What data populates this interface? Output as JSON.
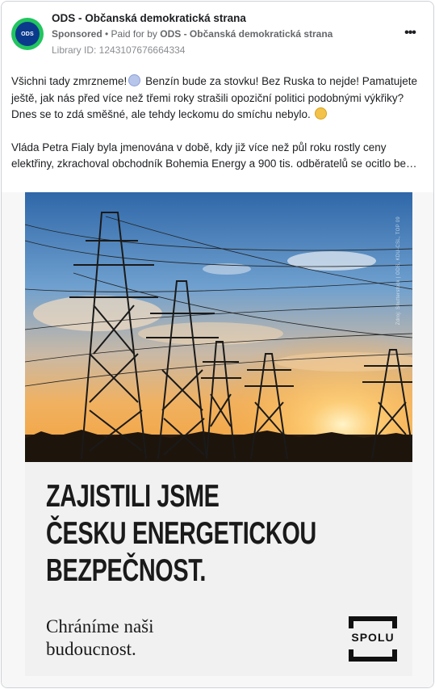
{
  "post": {
    "page_name": "ODS - Občanská demokratická strana",
    "avatar_text": "ODS",
    "sponsored_label": "Sponsored",
    "paid_for_prefix": "• Paid for by",
    "paid_for_name": "ODS - Občanská demokratická strana",
    "library_id": "Library ID: 1243107676664334",
    "more_icon": "more-horizontal-icon"
  },
  "body": {
    "line1_a": "Všichni tady zmrzneme!",
    "line1_b": "Benzín bude za stovku! Bez Ruska to nejde!",
    "line2": "Pamatujete ještě, jak nás před více než třemi roky strašili opoziční politici podobnými výkřiky? Dnes se to zdá směšné, ale tehdy leckomu do smíchu nebylo.",
    "para2": "Vláda Petra Fialy byla jmenována v době, kdy již více než půl roku rostly ceny elektřiny, zkrachoval obchodník Bohemia Energy a 900 tis. odběratelů se ocitlo be…"
  },
  "ad": {
    "headline_lines": [
      "ZAJISTILI JSME",
      "ČESKU ENERGETICKOU",
      "BEZPEČNOST."
    ],
    "tagline_lines": [
      "Chráníme naši",
      "budoucnost."
    ],
    "logo_text": "SPOLU",
    "photo_credit": "Zdroj: Shutterstock | ODS, KDU-ČSL, TOP 09",
    "colors": {
      "avatar_ring": "#22c55e",
      "avatar_fill": "#0b3a8c",
      "headline": "#1a1a1a",
      "panel": "#f1f1f1"
    }
  }
}
